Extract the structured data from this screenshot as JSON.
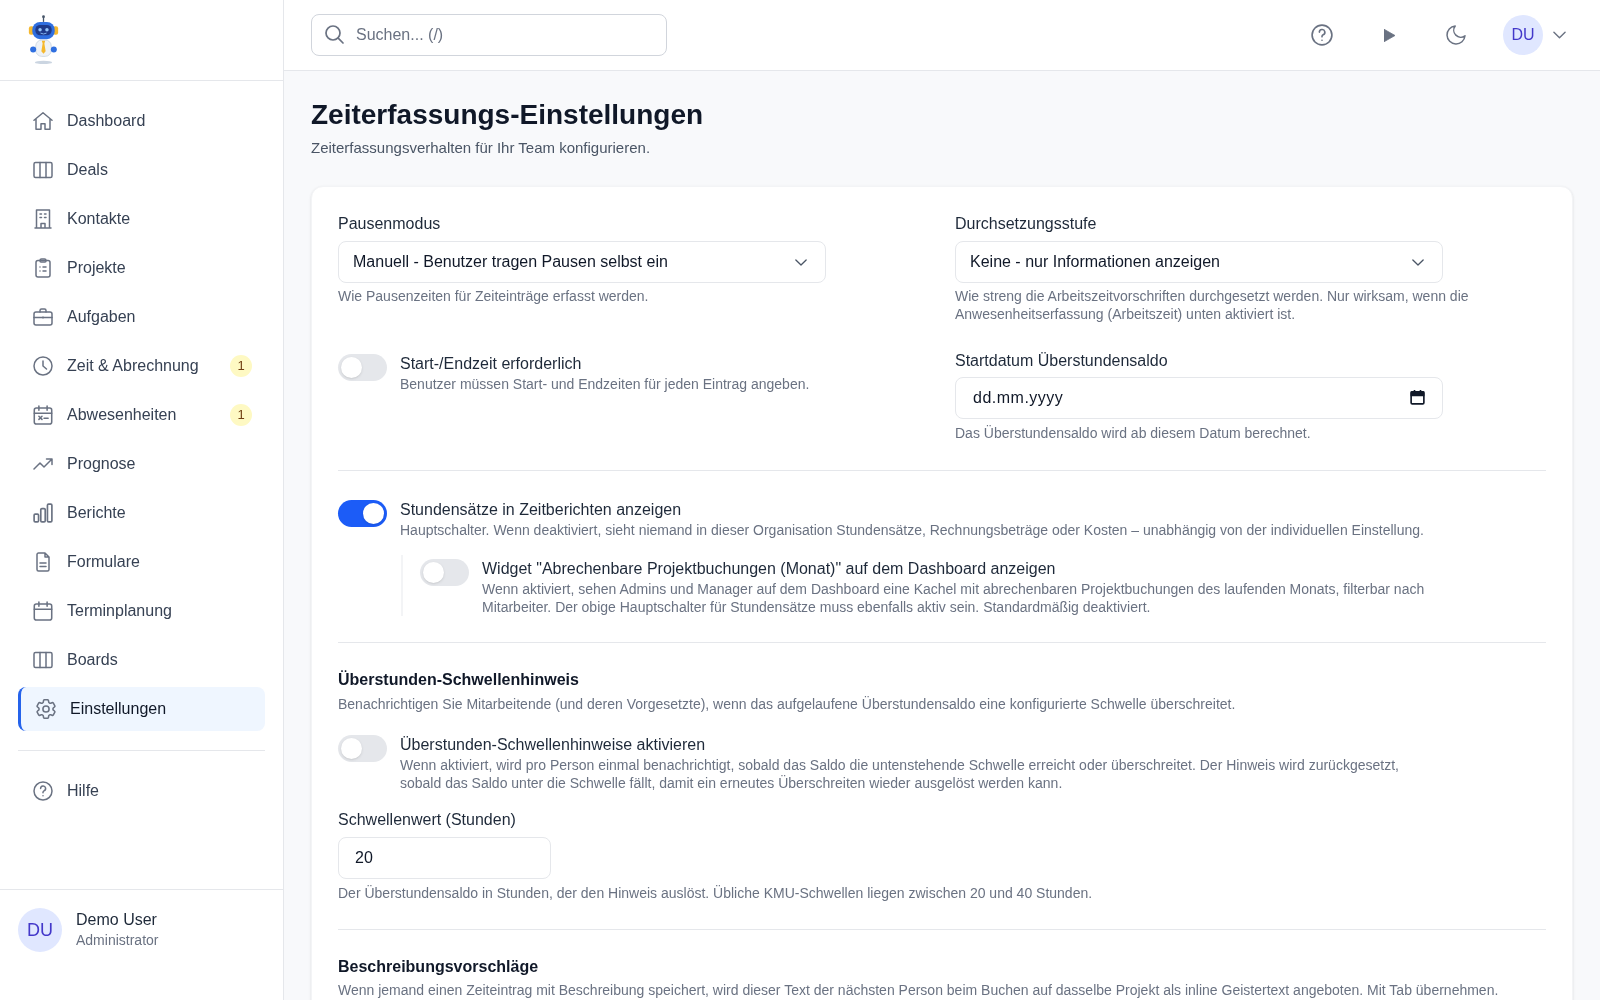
{
  "sidebar": {
    "items": [
      {
        "label": "Dashboard",
        "selected": false
      },
      {
        "label": "Deals",
        "selected": false
      },
      {
        "label": "Kontakte",
        "selected": false
      },
      {
        "label": "Projekte",
        "selected": false
      },
      {
        "label": "Aufgaben",
        "selected": false
      },
      {
        "label": "Zeit & Abrechnung",
        "selected": false,
        "badge": "1"
      },
      {
        "label": "Abwesenheiten",
        "selected": false,
        "badge": "1"
      },
      {
        "label": "Prognose",
        "selected": false
      },
      {
        "label": "Berichte",
        "selected": false
      },
      {
        "label": "Formulare",
        "selected": false
      },
      {
        "label": "Terminplanung",
        "selected": false
      },
      {
        "label": "Boards",
        "selected": false
      },
      {
        "label": "Einstellungen",
        "selected": true
      }
    ],
    "help_link": {
      "label": "Hilfe"
    },
    "user": {
      "initials": "DU",
      "name": "Demo User",
      "role": "Administrator"
    }
  },
  "header": {
    "search": {
      "placeholder": "Suchen... (/)"
    },
    "avatar": {
      "initials": "DU"
    }
  },
  "page": {
    "title": "Zeiterfassungs-Einstellungen",
    "subtitle": "Zeiterfassungsverhalten für Ihr Team konfigurieren."
  },
  "settings": {
    "break_mode": {
      "label": "Pausenmodus",
      "value": "Manuell - Benutzer tragen Pausen selbst ein",
      "help": "Wie Pausenzeiten für Zeiteinträge erfasst werden."
    },
    "enforcement_level": {
      "label": "Durchsetzungsstufe",
      "value": "Keine - nur Informationen anzeigen",
      "help": "Wie streng die Arbeitszeitvorschriften durchgesetzt werden. Nur wirksam, wenn die Anwesenheitserfassung (Arbeitszeit) unten aktiviert ist."
    },
    "start_end_required": {
      "label": "Start-/Endzeit erforderlich",
      "description": "Benutzer müssen Start- und Endzeiten für jeden Eintrag angeben.",
      "on": false
    },
    "overtime_start_date": {
      "label": "Startdatum Überstundensaldo",
      "placeholder": "dd.mm.yyyy",
      "help": "Das Überstundensaldo wird ab diesem Datum berechnet."
    },
    "hourly_rates": {
      "label": "Stundensätze in Zeitberichten anzeigen",
      "description": "Hauptschalter. Wenn deaktiviert, sieht niemand in dieser Organisation Stundensätze, Rechnungsbeträge oder Kosten – unabhängig von der individuellen Einstellung.",
      "on": true,
      "sub_toggle": {
        "label": "Widget \"Abrechenbare Projektbuchungen (Monat)\" auf dem Dashboard anzeigen",
        "description": "Wenn aktiviert, sehen Admins und Manager auf dem Dashboard eine Kachel mit abrechenbaren Projektbuchungen des laufenden Monats, filterbar nach Mitarbeiter. Der obige Hauptschalter für Stundensätze muss ebenfalls aktiv sein. Standardmäßig deaktiviert.",
        "on": false
      }
    },
    "overtime_threshold": {
      "heading": "Überstunden-Schwellenhinweis",
      "description": "Benachrichtigen Sie Mitarbeitende (und deren Vorgesetzte), wenn das aufgelaufene Überstundensaldo eine konfigurierte Schwelle überschreitet.",
      "toggle": {
        "label": "Überstunden-Schwellenhinweise aktivieren",
        "description": "Wenn aktiviert, wird pro Person einmal benachrichtigt, sobald das Saldo die untenstehende Schwelle erreicht oder überschreitet. Der Hinweis wird zurückgesetzt, sobald das Saldo unter die Schwelle fällt, damit ein erneutes Überschreiten wieder ausgelöst werden kann.",
        "on": false
      },
      "threshold": {
        "label": "Schwellenwert (Stunden)",
        "value": "20",
        "help": "Der Überstundensaldo in Stunden, der den Hinweis auslöst. Übliche KMU-Schwellen liegen zwischen 20 und 40 Stunden."
      }
    },
    "description_suggestions": {
      "heading": "Beschreibungsvorschläge",
      "description": "Wenn jemand einen Zeiteintrag mit Beschreibung speichert, wird dieser Text der nächsten Person beim Buchen auf dasselbe Projekt als inline Geistertext angeboten. Mit Tab übernehmen."
    }
  }
}
